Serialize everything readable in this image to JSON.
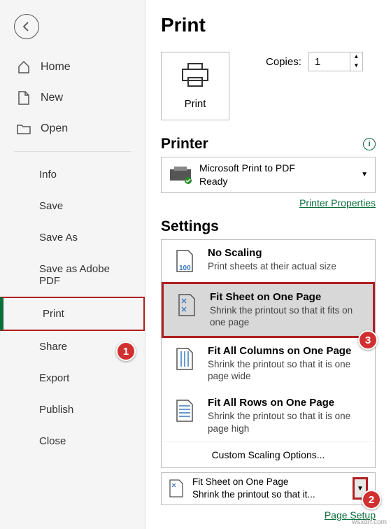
{
  "page_title": "Print",
  "sidebar": {
    "home": "Home",
    "new": "New",
    "open": "Open",
    "info": "Info",
    "save": "Save",
    "save_as": "Save As",
    "save_adobe": "Save as Adobe PDF",
    "print": "Print",
    "share": "Share",
    "export": "Export",
    "publish": "Publish",
    "close": "Close"
  },
  "print_button": "Print",
  "copies_label": "Copies:",
  "copies_value": "1",
  "printer_heading": "Printer",
  "printer": {
    "name": "Microsoft Print to PDF",
    "status": "Ready"
  },
  "printer_properties": "Printer Properties",
  "settings_heading": "Settings",
  "options": {
    "no_scaling": {
      "title": "No Scaling",
      "desc": "Print sheets at their actual size"
    },
    "fit_sheet": {
      "title": "Fit Sheet on One Page",
      "desc": "Shrink the printout so that it fits on one page"
    },
    "fit_cols": {
      "title": "Fit All Columns on One Page",
      "desc": "Shrink the printout so that it is one page wide"
    },
    "fit_rows": {
      "title": "Fit All Rows on One Page",
      "desc": "Shrink the printout so that it is one page high"
    },
    "custom": "Custom Scaling Options..."
  },
  "current": {
    "title": "Fit Sheet on One Page",
    "desc": "Shrink the printout so that it..."
  },
  "page_setup": "Page Setup",
  "markers": {
    "m1": "1",
    "m2": "2",
    "m3": "3"
  },
  "watermark": "wsxdn.com"
}
